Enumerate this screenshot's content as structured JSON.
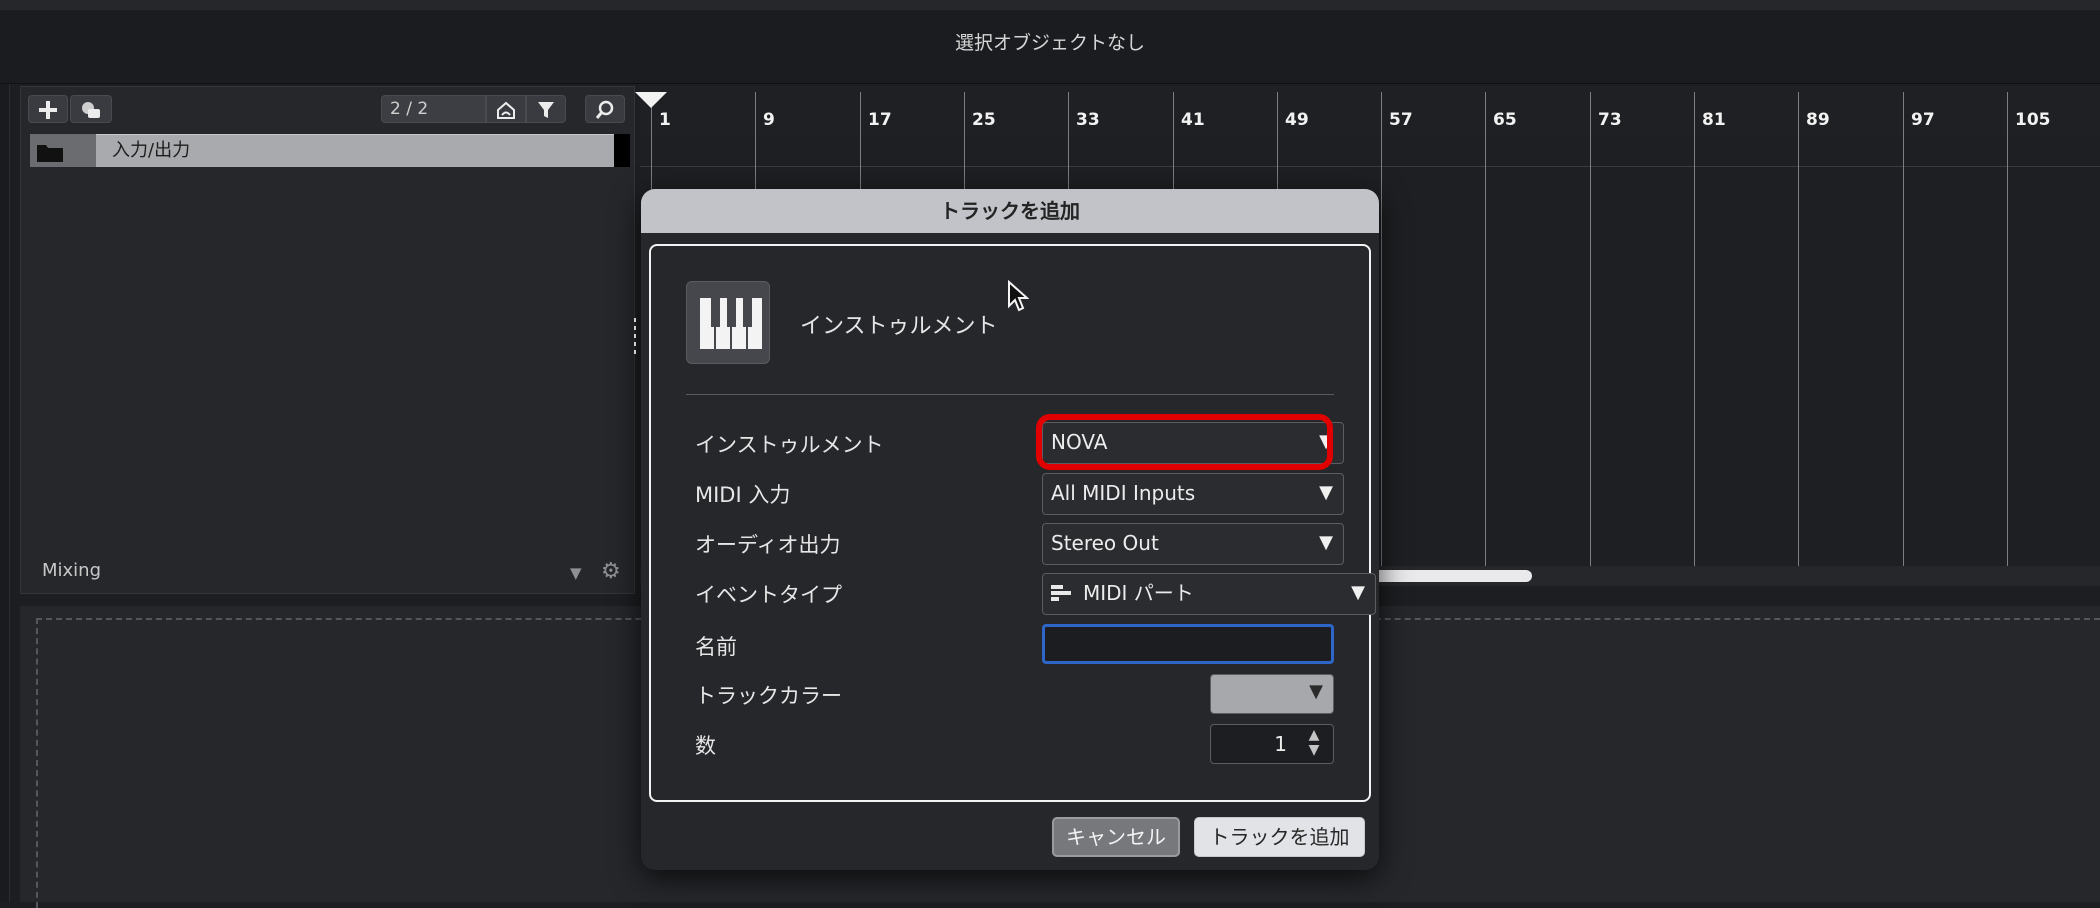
{
  "header": {
    "status": "選択オブジェクトなし"
  },
  "track_panel": {
    "add_icon": "plus-icon",
    "duplicate_icon": "duplicate-icon",
    "counter": "2 / 2",
    "show_icon": "home-icon",
    "filter_icon": "filter-icon",
    "search_icon": "search-icon",
    "tracks": [
      {
        "name": "入力/出力",
        "icon": "folder-icon"
      }
    ],
    "footer_label": "Mixing",
    "footer_icons": [
      "dropdown-triangle-icon",
      "gear-icon"
    ]
  },
  "timeline": {
    "ruler": [
      "1",
      "9",
      "17",
      "25",
      "33",
      "41",
      "49",
      "57",
      "65",
      "73",
      "81",
      "89",
      "97",
      "105"
    ]
  },
  "dialog": {
    "title": "トラックを追加",
    "header_label": "インストゥルメント",
    "header_icon": "piano-keys-icon",
    "fields": {
      "instrument": {
        "label": "インストゥルメント",
        "value": "NOVA"
      },
      "midi_input": {
        "label": "MIDI 入力",
        "value": "All MIDI Inputs"
      },
      "audio_output": {
        "label": "オーディオ出力",
        "value": "Stereo Out"
      },
      "event_type": {
        "label": "イベントタイプ",
        "value": "MIDI パート",
        "icon": "midi-part-icon"
      },
      "name": {
        "label": "名前",
        "value": ""
      },
      "track_color": {
        "label": "トラックカラー",
        "value_color": "#a7a8ab"
      },
      "count": {
        "label": "数",
        "value": "1"
      }
    },
    "dropdown_arrow": "▼",
    "highlight_color": "#e00000",
    "buttons": {
      "cancel": "キャンセル",
      "add": "トラックを追加"
    }
  }
}
